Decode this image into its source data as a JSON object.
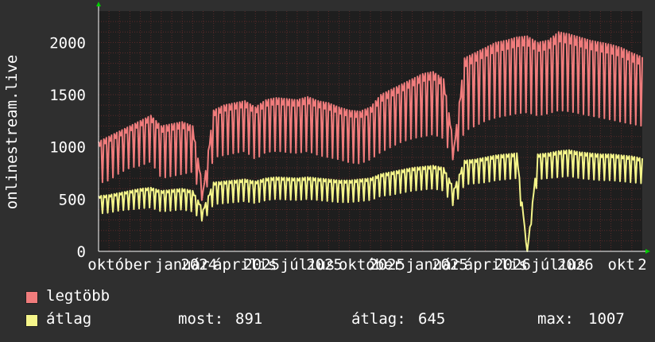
{
  "colors": {
    "background": "#2f2f2f",
    "plot_bg": "#1e1e1e",
    "grid": "#5a2a2a",
    "axis": "#ffffff",
    "arrow": "#00cc00",
    "series_max": "#f07c7c",
    "series_avg": "#f5f58a"
  },
  "chart_data": {
    "type": "line",
    "ylabel": "onlinestream.live",
    "ylim": [
      0,
      2300
    ],
    "yticks": [
      0,
      500,
      1000,
      1500,
      2000
    ],
    "xlim": [
      0,
      26
    ],
    "x_tick_labels": [
      {
        "x": 1,
        "label": "október"
      },
      {
        "x": 4,
        "label": "január"
      },
      {
        "x": 4.8,
        "label": "2024"
      },
      {
        "x": 7,
        "label": "április"
      },
      {
        "x": 7.8,
        "label": "2025"
      },
      {
        "x": 10,
        "label": "július"
      },
      {
        "x": 10.8,
        "label": "2025"
      },
      {
        "x": 13,
        "label": "október"
      },
      {
        "x": 13.8,
        "label": "2025"
      },
      {
        "x": 16,
        "label": "január"
      },
      {
        "x": 16.8,
        "label": "2025"
      },
      {
        "x": 19,
        "label": "április"
      },
      {
        "x": 19.8,
        "label": "2026"
      },
      {
        "x": 22,
        "label": "július"
      },
      {
        "x": 22.8,
        "label": "2026"
      },
      {
        "x": 25,
        "label": "okt"
      },
      {
        "x": 26,
        "label": "2"
      }
    ],
    "grid": true,
    "series": [
      {
        "name": "legtöbb",
        "key": "max",
        "x": [
          0,
          0.5,
          1,
          1.5,
          2,
          2.5,
          3,
          3.5,
          4,
          4.5,
          5,
          5.5,
          6,
          6.5,
          7,
          7.5,
          8,
          8.5,
          9,
          9.5,
          10,
          10.5,
          11,
          11.5,
          12,
          12.5,
          13,
          13.5,
          14,
          14.5,
          15,
          15.5,
          16,
          16.5,
          17,
          17.5,
          18,
          18.5,
          19,
          19.5,
          20,
          20.5,
          21,
          21.5,
          22,
          22.5,
          23,
          23.5,
          24,
          24.5,
          25,
          25.5,
          26
        ],
        "values": [
          1050,
          1100,
          1150,
          1200,
          1250,
          1300,
          1200,
          1220,
          1240,
          1200,
          580,
          1350,
          1400,
          1420,
          1440,
          1380,
          1450,
          1470,
          1460,
          1450,
          1480,
          1440,
          1420,
          1380,
          1350,
          1340,
          1380,
          1500,
          1550,
          1600,
          1650,
          1700,
          1720,
          1650,
          1000,
          1850,
          1900,
          1950,
          2000,
          2020,
          2050,
          2060,
          2000,
          2020,
          2100,
          2080,
          2050,
          2020,
          2000,
          1980,
          1950,
          1900,
          1860
        ],
        "dips": [
          650,
          680,
          750,
          800,
          820,
          860,
          700,
          720,
          740,
          760,
          450,
          900,
          920,
          940,
          960,
          880,
          950,
          960,
          950,
          940,
          960,
          920,
          900,
          880,
          850,
          840,
          880,
          950,
          1000,
          1050,
          1080,
          1100,
          1120,
          1080,
          850,
          1150,
          1200,
          1250,
          1280,
          1300,
          1320,
          1330,
          1300,
          1320,
          1350,
          1340,
          1320,
          1300,
          1280,
          1260,
          1240,
          1220,
          1200
        ]
      },
      {
        "name": "átlag",
        "key": "avg",
        "x": [
          0,
          0.5,
          1,
          1.5,
          2,
          2.5,
          3,
          3.5,
          4,
          4.5,
          5,
          5.5,
          6,
          6.5,
          7,
          7.5,
          8,
          8.5,
          9,
          9.5,
          10,
          10.5,
          11,
          11.5,
          12,
          12.5,
          13,
          13.5,
          14,
          14.5,
          15,
          15.5,
          16,
          16.5,
          17,
          17.5,
          18,
          18.5,
          19,
          19.5,
          20,
          20.5,
          21,
          21.5,
          22,
          22.5,
          23,
          23.5,
          24,
          24.5,
          25,
          25.5,
          26
        ],
        "values": [
          530,
          540,
          560,
          580,
          600,
          610,
          580,
          590,
          600,
          580,
          400,
          660,
          670,
          680,
          690,
          670,
          700,
          710,
          705,
          700,
          710,
          700,
          690,
          680,
          680,
          690,
          700,
          740,
          760,
          780,
          800,
          810,
          820,
          800,
          600,
          870,
          880,
          900,
          920,
          930,
          940,
          0,
          930,
          940,
          960,
          970,
          950,
          940,
          930,
          930,
          920,
          910,
          890
        ],
        "dips": [
          360,
          370,
          390,
          400,
          410,
          420,
          380,
          390,
          400,
          380,
          280,
          450,
          460,
          470,
          480,
          460,
          490,
          500,
          495,
          490,
          500,
          490,
          480,
          470,
          470,
          480,
          490,
          530,
          540,
          560,
          580,
          590,
          600,
          580,
          420,
          640,
          650,
          660,
          680,
          690,
          700,
          0,
          690,
          700,
          710,
          720,
          700,
          690,
          680,
          680,
          670,
          660,
          650
        ]
      }
    ]
  },
  "legend": {
    "max_label": "legtöbb",
    "avg_label": "átlag",
    "now_label": "most:",
    "now_value": "891",
    "mean_label": "átlag:",
    "mean_value": "645",
    "peak_label": "max:",
    "peak_value": "1007"
  }
}
